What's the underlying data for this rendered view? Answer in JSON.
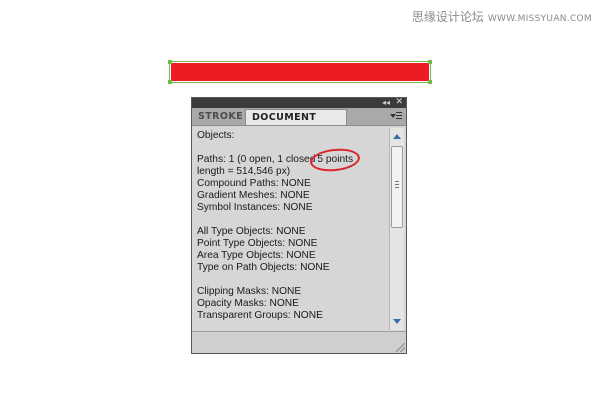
{
  "watermark": {
    "chinese": "思缘设计论坛",
    "url": "WWW.MISSYUAN.COM"
  },
  "shape": {
    "fill_color": "#ed1c24",
    "selection_color": "#74b84c"
  },
  "panel": {
    "collapse_glyph": "◂◂",
    "close_glyph": "✕",
    "tabs": {
      "stroke": "STROKE",
      "document_info": "DOCUMENT INFO"
    },
    "content": {
      "objects": "Objects:",
      "paths_prefix": "Paths: 1 (0 open, 1 closed",
      "paths_highlight": "5 points",
      "length": "length = 514,546 px)",
      "compound_paths": "Compound Paths: NONE",
      "gradient_meshes": "Gradient Meshes: NONE",
      "symbol_instances": "Symbol Instances: NONE",
      "all_type": "All Type Objects: NONE",
      "point_type": "Point Type Objects: NONE",
      "area_type": "Area Type Objects: NONE",
      "type_on_path": "Type on Path Objects: NONE",
      "clipping_masks": "Clipping Masks: NONE",
      "opacity_masks": "Opacity Masks: NONE",
      "transparent_groups": "Transparent Groups: NONE"
    },
    "highlight_color": "#d9262a"
  }
}
